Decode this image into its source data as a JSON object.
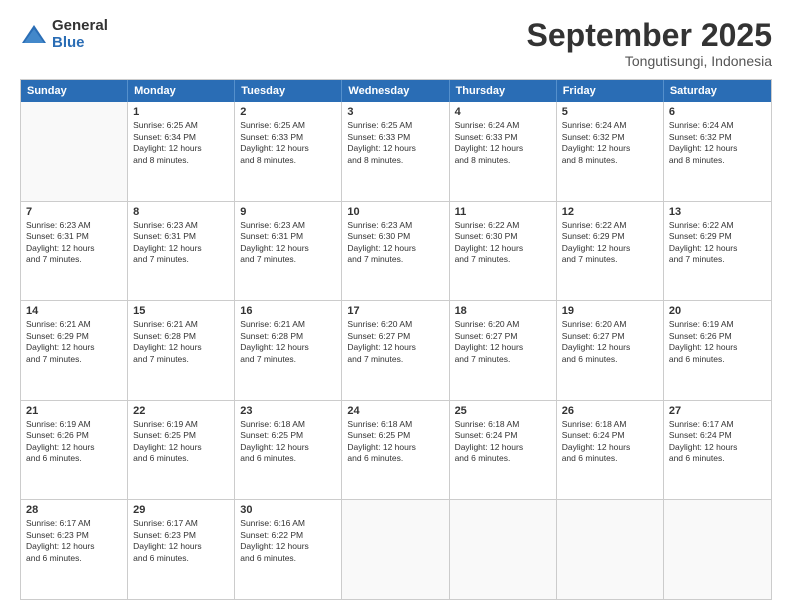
{
  "logo": {
    "general": "General",
    "blue": "Blue"
  },
  "header": {
    "month": "September 2025",
    "location": "Tongutisungi, Indonesia"
  },
  "days": [
    "Sunday",
    "Monday",
    "Tuesday",
    "Wednesday",
    "Thursday",
    "Friday",
    "Saturday"
  ],
  "weeks": [
    [
      {
        "day": "",
        "info": ""
      },
      {
        "day": "1",
        "info": "Sunrise: 6:25 AM\nSunset: 6:34 PM\nDaylight: 12 hours\nand 8 minutes."
      },
      {
        "day": "2",
        "info": "Sunrise: 6:25 AM\nSunset: 6:33 PM\nDaylight: 12 hours\nand 8 minutes."
      },
      {
        "day": "3",
        "info": "Sunrise: 6:25 AM\nSunset: 6:33 PM\nDaylight: 12 hours\nand 8 minutes."
      },
      {
        "day": "4",
        "info": "Sunrise: 6:24 AM\nSunset: 6:33 PM\nDaylight: 12 hours\nand 8 minutes."
      },
      {
        "day": "5",
        "info": "Sunrise: 6:24 AM\nSunset: 6:32 PM\nDaylight: 12 hours\nand 8 minutes."
      },
      {
        "day": "6",
        "info": "Sunrise: 6:24 AM\nSunset: 6:32 PM\nDaylight: 12 hours\nand 8 minutes."
      }
    ],
    [
      {
        "day": "7",
        "info": "Sunrise: 6:23 AM\nSunset: 6:31 PM\nDaylight: 12 hours\nand 7 minutes."
      },
      {
        "day": "8",
        "info": "Sunrise: 6:23 AM\nSunset: 6:31 PM\nDaylight: 12 hours\nand 7 minutes."
      },
      {
        "day": "9",
        "info": "Sunrise: 6:23 AM\nSunset: 6:31 PM\nDaylight: 12 hours\nand 7 minutes."
      },
      {
        "day": "10",
        "info": "Sunrise: 6:23 AM\nSunset: 6:30 PM\nDaylight: 12 hours\nand 7 minutes."
      },
      {
        "day": "11",
        "info": "Sunrise: 6:22 AM\nSunset: 6:30 PM\nDaylight: 12 hours\nand 7 minutes."
      },
      {
        "day": "12",
        "info": "Sunrise: 6:22 AM\nSunset: 6:29 PM\nDaylight: 12 hours\nand 7 minutes."
      },
      {
        "day": "13",
        "info": "Sunrise: 6:22 AM\nSunset: 6:29 PM\nDaylight: 12 hours\nand 7 minutes."
      }
    ],
    [
      {
        "day": "14",
        "info": "Sunrise: 6:21 AM\nSunset: 6:29 PM\nDaylight: 12 hours\nand 7 minutes."
      },
      {
        "day": "15",
        "info": "Sunrise: 6:21 AM\nSunset: 6:28 PM\nDaylight: 12 hours\nand 7 minutes."
      },
      {
        "day": "16",
        "info": "Sunrise: 6:21 AM\nSunset: 6:28 PM\nDaylight: 12 hours\nand 7 minutes."
      },
      {
        "day": "17",
        "info": "Sunrise: 6:20 AM\nSunset: 6:27 PM\nDaylight: 12 hours\nand 7 minutes."
      },
      {
        "day": "18",
        "info": "Sunrise: 6:20 AM\nSunset: 6:27 PM\nDaylight: 12 hours\nand 7 minutes."
      },
      {
        "day": "19",
        "info": "Sunrise: 6:20 AM\nSunset: 6:27 PM\nDaylight: 12 hours\nand 6 minutes."
      },
      {
        "day": "20",
        "info": "Sunrise: 6:19 AM\nSunset: 6:26 PM\nDaylight: 12 hours\nand 6 minutes."
      }
    ],
    [
      {
        "day": "21",
        "info": "Sunrise: 6:19 AM\nSunset: 6:26 PM\nDaylight: 12 hours\nand 6 minutes."
      },
      {
        "day": "22",
        "info": "Sunrise: 6:19 AM\nSunset: 6:25 PM\nDaylight: 12 hours\nand 6 minutes."
      },
      {
        "day": "23",
        "info": "Sunrise: 6:18 AM\nSunset: 6:25 PM\nDaylight: 12 hours\nand 6 minutes."
      },
      {
        "day": "24",
        "info": "Sunrise: 6:18 AM\nSunset: 6:25 PM\nDaylight: 12 hours\nand 6 minutes."
      },
      {
        "day": "25",
        "info": "Sunrise: 6:18 AM\nSunset: 6:24 PM\nDaylight: 12 hours\nand 6 minutes."
      },
      {
        "day": "26",
        "info": "Sunrise: 6:18 AM\nSunset: 6:24 PM\nDaylight: 12 hours\nand 6 minutes."
      },
      {
        "day": "27",
        "info": "Sunrise: 6:17 AM\nSunset: 6:24 PM\nDaylight: 12 hours\nand 6 minutes."
      }
    ],
    [
      {
        "day": "28",
        "info": "Sunrise: 6:17 AM\nSunset: 6:23 PM\nDaylight: 12 hours\nand 6 minutes."
      },
      {
        "day": "29",
        "info": "Sunrise: 6:17 AM\nSunset: 6:23 PM\nDaylight: 12 hours\nand 6 minutes."
      },
      {
        "day": "30",
        "info": "Sunrise: 6:16 AM\nSunset: 6:22 PM\nDaylight: 12 hours\nand 6 minutes."
      },
      {
        "day": "",
        "info": ""
      },
      {
        "day": "",
        "info": ""
      },
      {
        "day": "",
        "info": ""
      },
      {
        "day": "",
        "info": ""
      }
    ]
  ]
}
